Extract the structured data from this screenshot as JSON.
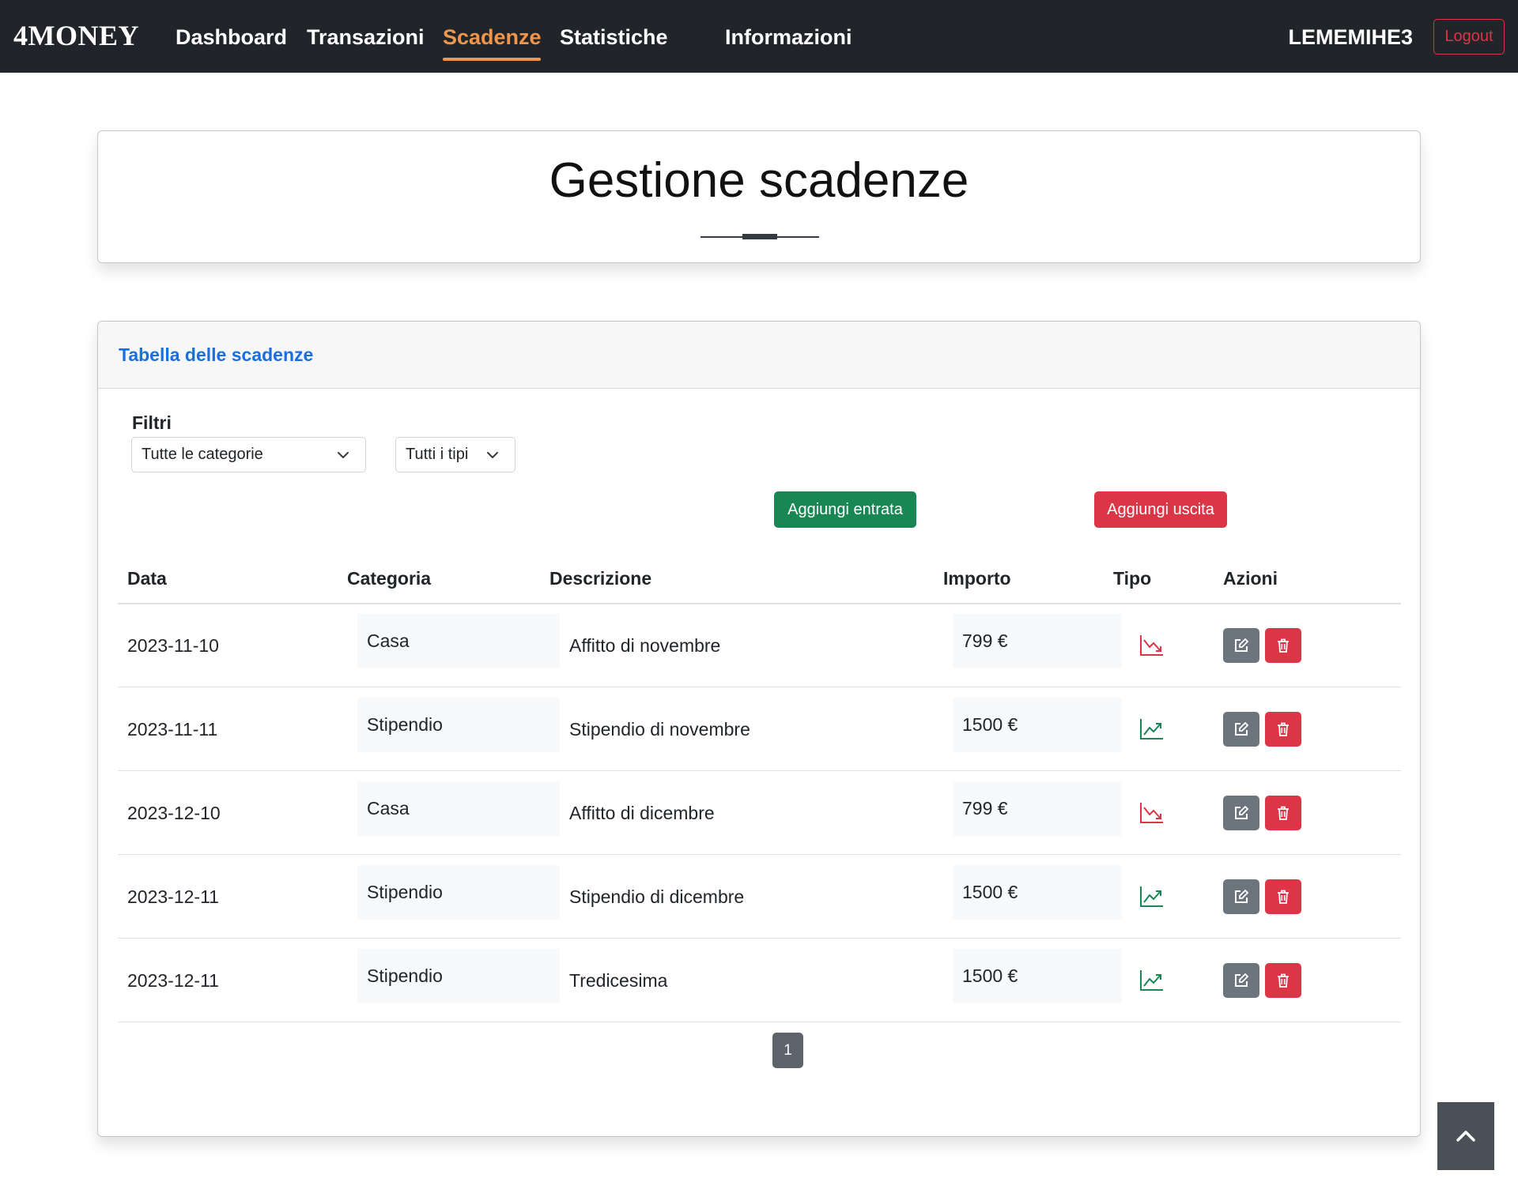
{
  "navbar": {
    "brand": "4MONEY",
    "links": [
      {
        "label": "Dashboard"
      },
      {
        "label": "Transazioni"
      },
      {
        "label": "Scadenze"
      },
      {
        "label": "Statistiche"
      },
      {
        "label": "Informazioni"
      }
    ],
    "active": "Scadenze",
    "username": "LEMEMIHE3",
    "logout_label": "Logout"
  },
  "header": {
    "title": "Gestione scadenze"
  },
  "card": {
    "title": "Tabella delle scadenze",
    "filters_label": "Filtri",
    "category_filter": "Tutte le categorie",
    "type_filter": "Tutti i tipi",
    "add_income_label": "Aggiungi entrata",
    "add_expense_label": "Aggiungi uscita"
  },
  "table": {
    "headers": [
      "Data",
      "Categoria",
      "Descrizione",
      "Importo",
      "Tipo",
      "Azioni"
    ],
    "rows": [
      {
        "data": "2023-11-10",
        "categoria": "Casa",
        "descrizione": "Affitto di novembre",
        "importo": "799 €",
        "tipo": "trend-down-icon"
      },
      {
        "data": "2023-11-11",
        "categoria": "Stipendio",
        "descrizione": "Stipendio di novembre",
        "importo": "1500 €",
        "tipo": "trend-up-icon"
      },
      {
        "data": "2023-12-10",
        "categoria": "Casa",
        "descrizione": "Affitto di dicembre",
        "importo": "799 €",
        "tipo": "trend-down-icon"
      },
      {
        "data": "2023-12-11",
        "categoria": "Stipendio",
        "descrizione": "Stipendio di dicembre",
        "importo": "1500 €",
        "tipo": "trend-up-icon"
      },
      {
        "data": "2023-12-11",
        "categoria": "Stipendio",
        "descrizione": "Tredicesima",
        "importo": "1500 €",
        "tipo": "trend-up-icon"
      }
    ]
  },
  "pagination": {
    "current_page": "1"
  },
  "colors": {
    "navbar_bg": "#212529",
    "active_link": "#f0954a",
    "income": "#198754",
    "expense": "#dc3545",
    "card_title": "#1a6fe0"
  }
}
